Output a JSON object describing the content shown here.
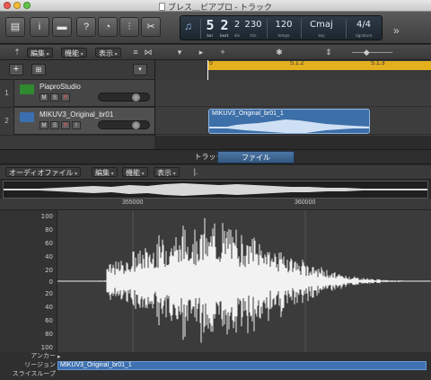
{
  "window": {
    "title": "ブレス＿ピアプロ - トラック"
  },
  "lcd": {
    "bar": "5",
    "beat": "2",
    "division": "2",
    "tick": "230",
    "bar_label": "bar",
    "beat_label": "beat",
    "div_label": "div",
    "tick_label": "tick",
    "tempo": "120",
    "tempo_label": "tempo",
    "key": "Cmaj",
    "key_label": "key",
    "signature": "4/4",
    "signature_label": "signature"
  },
  "tracks_toolbar": {
    "edit": "編集",
    "functions": "機能",
    "view": "表示"
  },
  "ruler": {
    "marks": [
      "5",
      "5.1.2",
      "5.1.3"
    ]
  },
  "tracks": [
    {
      "num": "1",
      "name": "PiaproStudio",
      "color": "#2f8a2f"
    },
    {
      "num": "2",
      "name": "MIKUV3_Original_br01",
      "color": "#3b6fb0"
    }
  ],
  "track_buttons": {
    "mute": "M",
    "solo": "S",
    "record": "R",
    "input": "I"
  },
  "region": {
    "name": "MIKUV3_Original_br01_1"
  },
  "editor": {
    "tab_track": "トラック",
    "tab_file": "ファイル",
    "menu_audio_file": "オーディオファイル",
    "menu_edit": "編集",
    "menu_functions": "機能",
    "menu_view": "表示",
    "ruler_labels": [
      "355000",
      "360000"
    ],
    "scale": [
      "100",
      "80",
      "60",
      "40",
      "20",
      "0",
      "20",
      "40",
      "60",
      "80",
      "100"
    ],
    "row_anchor": "アンカー",
    "row_region": "リージョン",
    "row_slice_loop": "スライスループ",
    "region_bar_name": "MIKUV3_Original_br01_1"
  },
  "colors": {
    "cycle": "#e4b01e",
    "region": "#3d6fa8",
    "active_tab": "#4c76a6"
  }
}
